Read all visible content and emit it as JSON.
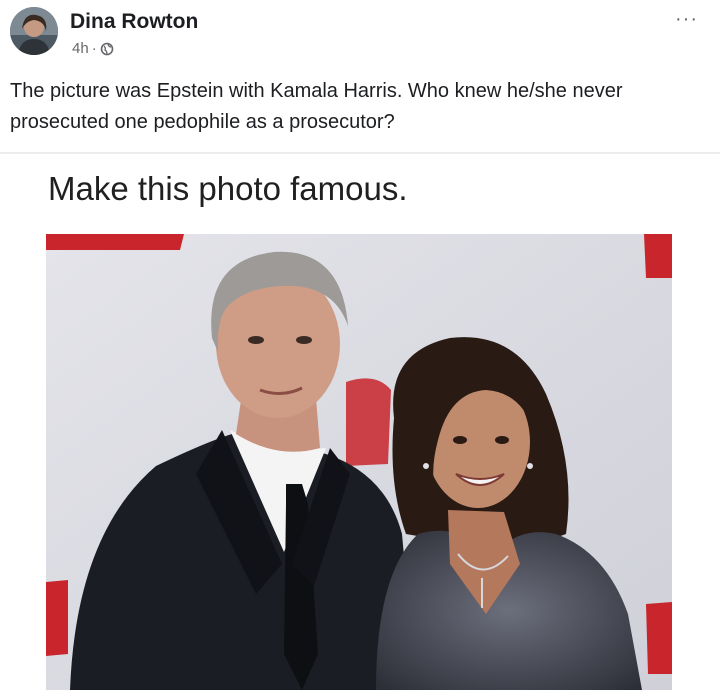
{
  "post": {
    "author": "Dina Rowton",
    "time": "4h",
    "separator": "·",
    "privacy_icon": "globe-icon",
    "more_icon": "more-options-icon",
    "more_label": "···",
    "text": "The picture was Epstein with Kamala Harris.  Who knew he/she never prosecuted one pedophile as a prosecutor?"
  },
  "shared_image": {
    "caption": "Make this photo famous."
  },
  "colors": {
    "text": "#1c1e21",
    "meta": "#65676b",
    "backdrop": "#d9dbe1",
    "backdrop_red": "#c8252c"
  }
}
